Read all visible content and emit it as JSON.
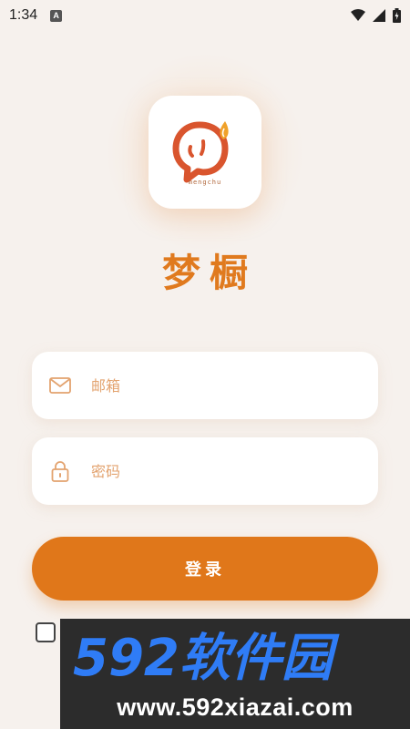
{
  "status_bar": {
    "time": "1:34",
    "notification_letter": "A"
  },
  "app": {
    "name": "梦橱",
    "logo_text": "mengchu"
  },
  "form": {
    "email_placeholder": "邮箱",
    "password_placeholder": "密码",
    "login_label": "登录"
  },
  "icons": {
    "email": "mail-icon",
    "password": "lock-icon",
    "wifi": "wifi-icon",
    "signal": "signal-icon",
    "battery": "battery-icon"
  },
  "watermark": {
    "logo_text": "592软件园",
    "url": "www.592xiazai.com"
  },
  "colors": {
    "accent": "#e0771a",
    "background": "#f6f1ed",
    "placeholder": "#e3a36f"
  }
}
